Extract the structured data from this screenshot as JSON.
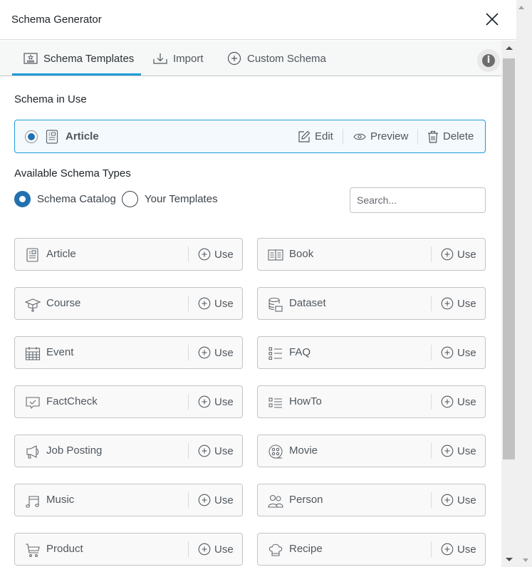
{
  "dialog": {
    "title": "Schema Generator",
    "close_icon": "close-icon"
  },
  "tabs": [
    {
      "label": "Schema Templates",
      "icon": "templates-icon",
      "active": true
    },
    {
      "label": "Import",
      "icon": "import-icon",
      "active": false
    },
    {
      "label": "Custom Schema",
      "icon": "plus-circle-icon",
      "active": false
    }
  ],
  "info_icon": "info-icon",
  "schema_in_use": {
    "heading": "Schema in Use",
    "name": "Article",
    "selected": true,
    "actions": {
      "edit": "Edit",
      "preview": "Preview",
      "delete": "Delete"
    }
  },
  "available": {
    "heading": "Available Schema Types",
    "sources": [
      {
        "label": "Schema Catalog",
        "checked": true
      },
      {
        "label": "Your Templates",
        "checked": false
      }
    ],
    "search_placeholder": "Search...",
    "use_label": "Use",
    "types": [
      {
        "label": "Article",
        "icon": "article-icon"
      },
      {
        "label": "Book",
        "icon": "book-icon"
      },
      {
        "label": "Course",
        "icon": "graduation-cap-icon"
      },
      {
        "label": "Dataset",
        "icon": "database-icon"
      },
      {
        "label": "Event",
        "icon": "calendar-icon"
      },
      {
        "label": "FAQ",
        "icon": "list-icon"
      },
      {
        "label": "FactCheck",
        "icon": "chat-check-icon"
      },
      {
        "label": "HowTo",
        "icon": "steps-list-icon"
      },
      {
        "label": "Job Posting",
        "icon": "megaphone-icon"
      },
      {
        "label": "Movie",
        "icon": "film-reel-icon"
      },
      {
        "label": "Music",
        "icon": "music-note-icon"
      },
      {
        "label": "Person",
        "icon": "people-icon"
      },
      {
        "label": "Product",
        "icon": "cart-icon"
      },
      {
        "label": "Recipe",
        "icon": "chef-hat-icon"
      }
    ]
  },
  "colors": {
    "accent": "#1e9ddb",
    "radio": "#2271b1",
    "in_use_bg": "#f3f9fd"
  }
}
